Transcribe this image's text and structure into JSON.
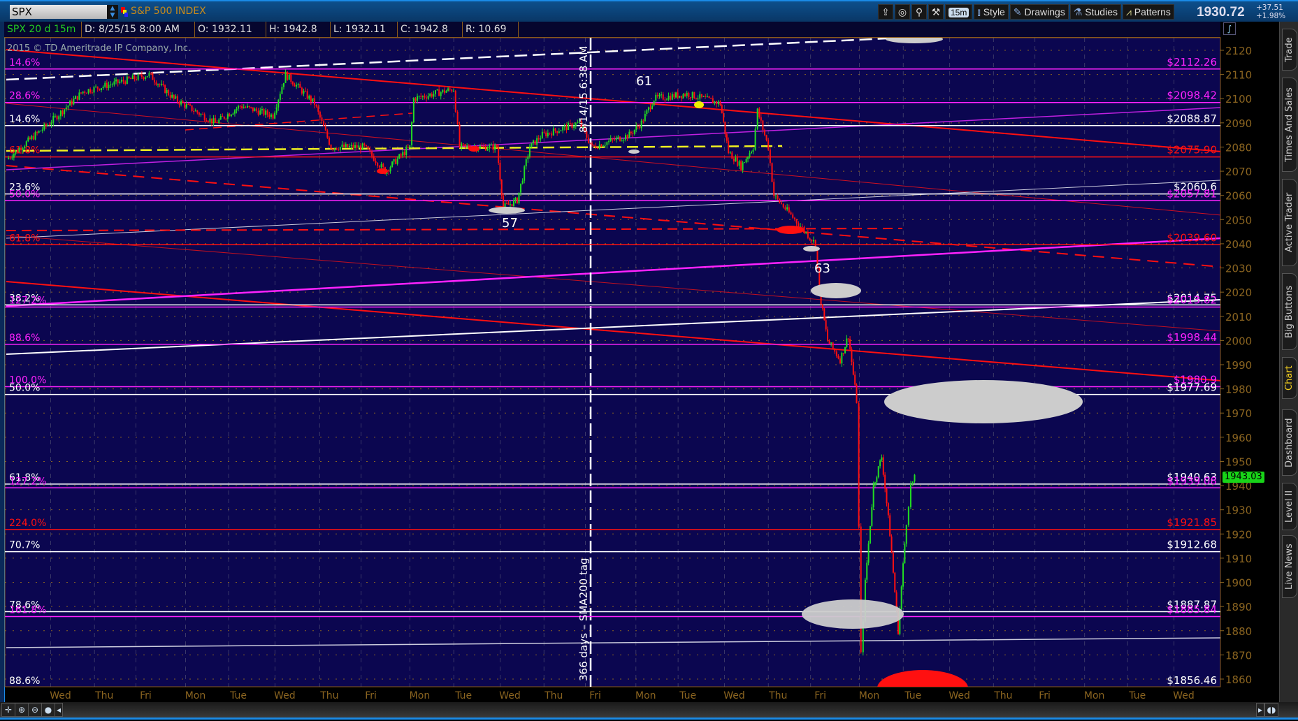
{
  "symbol": {
    "ticker": "SPX",
    "description": "S&P 500 INDEX"
  },
  "toolbar": {
    "interval": "15m",
    "style": "Style",
    "drawings": "Drawings",
    "studies": "Studies",
    "patterns": "Patterns",
    "last": "1930.72",
    "change": "+37.51",
    "change_pct": "+1.98%"
  },
  "info": {
    "study": "SPX 20 d 15m",
    "date": "D: 8/25/15 8:00 AM",
    "open": "O: 1932.11",
    "high": "H: 1942.8",
    "low": "L: 1932.11",
    "close": "C: 1942.8",
    "range": "R: 10.69"
  },
  "copyright": "2015 © TD Ameritrade IP Company, Inc.",
  "side_tabs": [
    "Trade",
    "Times And Sales",
    "Active Trader",
    "Big Buttons",
    "Chart",
    "Dashboard",
    "Level II",
    "Live News"
  ],
  "colors": {
    "chart_bg": "#0b0650",
    "axis_text": "#8a6420",
    "up": "#22dd22",
    "down": "#ff1010",
    "magenta": "#ff22ff",
    "active_tab": "#f5d020"
  },
  "chart_data": {
    "type": "candlestick",
    "ylim": [
      1855,
      2125
    ],
    "yticks": [
      2120,
      2110,
      2100,
      2090,
      2080,
      2070,
      2060,
      2050,
      2040,
      2030,
      2020,
      2010,
      2000,
      1990,
      1980,
      1970,
      1960,
      1950,
      1940,
      1930,
      1920,
      1910,
      1900,
      1890,
      1880,
      1870,
      1860
    ],
    "xticks": [
      "Wed",
      "Thu",
      "Fri",
      "Mon",
      "Tue",
      "Wed",
      "Thu",
      "Fri",
      "Mon",
      "Tue",
      "Wed",
      "Thu",
      "Fri",
      "Mon",
      "Tue",
      "Wed",
      "Thu",
      "Fri",
      "Mon",
      "Tue",
      "Wed",
      "Thu",
      "Fri",
      "Mon",
      "Tue",
      "Wed"
    ],
    "current_price": "1943.03",
    "price_path": [
      [
        -1.24,
        2075
      ],
      [
        -0.25,
        2090
      ],
      [
        0.52,
        2103
      ],
      [
        2.05,
        2110
      ],
      [
        2.62,
        2100
      ],
      [
        3.58,
        2090
      ],
      [
        4.15,
        2097
      ],
      [
        4.91,
        2093
      ],
      [
        5.2,
        2110
      ],
      [
        5.87,
        2098
      ],
      [
        6.25,
        2080
      ],
      [
        7.02,
        2080
      ],
      [
        7.5,
        2070
      ],
      [
        8.07,
        2080
      ],
      [
        8.16,
        2100
      ],
      [
        9.08,
        2104
      ],
      [
        9.22,
        2080
      ],
      [
        10.08,
        2080
      ],
      [
        10.23,
        2055
      ],
      [
        10.55,
        2058
      ],
      [
        10.84,
        2080
      ],
      [
        11.13,
        2085
      ],
      [
        11.99,
        2090
      ],
      [
        12.28,
        2080
      ],
      [
        13.14,
        2085
      ],
      [
        13.42,
        2090
      ],
      [
        13.71,
        2100
      ],
      [
        14.47,
        2102
      ],
      [
        15.24,
        2098
      ],
      [
        15.43,
        2078
      ],
      [
        15.72,
        2072
      ],
      [
        16.0,
        2080
      ],
      [
        16.1,
        2095
      ],
      [
        16.35,
        2080
      ],
      [
        16.48,
        2060
      ],
      [
        16.96,
        2050
      ],
      [
        17.44,
        2040
      ],
      [
        17.53,
        2020
      ],
      [
        17.72,
        2000
      ],
      [
        18.01,
        1992
      ],
      [
        18.2,
        2002
      ],
      [
        18.39,
        1975
      ],
      [
        18.49,
        1870
      ],
      [
        18.59,
        1900
      ],
      [
        18.78,
        1940
      ],
      [
        18.97,
        1952
      ],
      [
        19.16,
        1920
      ],
      [
        19.35,
        1880
      ],
      [
        19.54,
        1925
      ],
      [
        19.64,
        1940
      ],
      [
        19.73,
        1943
      ]
    ],
    "levels": [
      {
        "price": 2112.26,
        "right": "$2112.26",
        "left": "14.6%",
        "color": "#ff22ff"
      },
      {
        "price": 2098.42,
        "right": "$2098.42",
        "left": "28.6%",
        "color": "#ff22ff"
      },
      {
        "price": 2088.87,
        "right": "$2088.87",
        "left": "14.6%",
        "color": "#ffffff"
      },
      {
        "price": 2075.9,
        "right": "$2075.90",
        "left": "61.8%",
        "color": "#ff1010"
      },
      {
        "price": 2060.6,
        "right": "$2060.6",
        "left": "23.6%",
        "color": "#ffffff"
      },
      {
        "price": 2057.81,
        "right": "$2057.81",
        "left": "50.0%",
        "color": "#ff22ff"
      },
      {
        "price": 2039.6,
        "right": "$2039.60",
        "left": "61.8%",
        "color": "#ff1010"
      },
      {
        "price": 2014.75,
        "right": "$2014.75",
        "left": "38.2%",
        "color": "#ffffff"
      },
      {
        "price": 2013.82,
        "right": "$2013.82",
        "left": "127.2%",
        "color": "#ff22ff"
      },
      {
        "price": 1998.44,
        "right": "$1998.44",
        "left": "88.6%",
        "color": "#ff22ff"
      },
      {
        "price": 1980.9,
        "right": "$1980.9",
        "left": "100.0%",
        "color": "#ff22ff"
      },
      {
        "price": 1977.69,
        "right": "$1977.69",
        "left": "50.0%",
        "color": "#ffffff"
      },
      {
        "price": 1940.63,
        "right": "$1940.63",
        "left": "61.8%",
        "color": "#ffffff"
      },
      {
        "price": 1939.08,
        "right": "$1939.08",
        "left": "127.2%",
        "color": "#ff22ff"
      },
      {
        "price": 1921.85,
        "right": "$1921.85",
        "left": "224.0%",
        "color": "#ff1010"
      },
      {
        "price": 1912.68,
        "right": "$1912.68",
        "left": "70.7%",
        "color": "#ffffff"
      },
      {
        "price": 1887.87,
        "right": "$1887.87",
        "left": "78.6%",
        "color": "#ffffff"
      },
      {
        "price": 1885.84,
        "right": "$1885.84",
        "left": "161.8%",
        "color": "#ff22ff"
      },
      {
        "price": 1856.46,
        "right": "$1856.46",
        "left": "88.6%",
        "color": "#ffffff"
      }
    ],
    "annotations": {
      "a57": "57",
      "a61": "61",
      "a63": "63",
      "vline_top": "8/14/15 6:38 AM",
      "vline_bottom": "366 days – SMA200 tag"
    }
  }
}
